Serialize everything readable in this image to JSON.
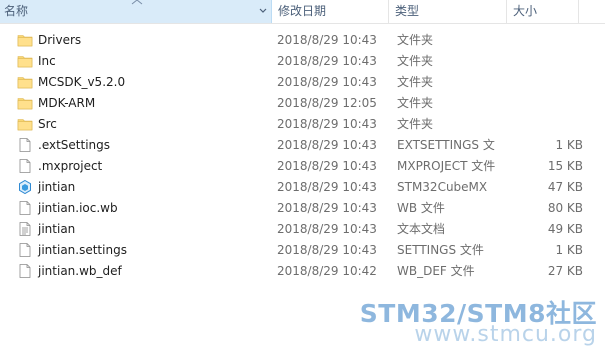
{
  "header": {
    "name": "名称",
    "date": "修改日期",
    "type": "类型",
    "size": "大小"
  },
  "files": [
    {
      "name": "Drivers",
      "date": "2018/8/29 10:43",
      "type": "文件夹",
      "size": "",
      "icon": "folder-icon"
    },
    {
      "name": "Inc",
      "date": "2018/8/29 10:43",
      "type": "文件夹",
      "size": "",
      "icon": "folder-icon"
    },
    {
      "name": "MCSDK_v5.2.0",
      "date": "2018/8/29 10:43",
      "type": "文件夹",
      "size": "",
      "icon": "folder-icon"
    },
    {
      "name": "MDK-ARM",
      "date": "2018/8/29 12:05",
      "type": "文件夹",
      "size": "",
      "icon": "folder-icon"
    },
    {
      "name": "Src",
      "date": "2018/8/29 10:43",
      "type": "文件夹",
      "size": "",
      "icon": "folder-icon"
    },
    {
      "name": ".extSettings",
      "date": "2018/8/29 10:43",
      "type": "EXTSETTINGS 文",
      "size": "1 KB",
      "icon": "file-icon"
    },
    {
      "name": ".mxproject",
      "date": "2018/8/29 10:43",
      "type": "MXPROJECT 文件",
      "size": "15 KB",
      "icon": "file-icon"
    },
    {
      "name": "jintian",
      "date": "2018/8/29 10:43",
      "type": "STM32CubeMX",
      "size": "47 KB",
      "icon": "cubemx-icon"
    },
    {
      "name": "jintian.ioc.wb",
      "date": "2018/8/29 10:43",
      "type": "WB 文件",
      "size": "80 KB",
      "icon": "file-icon"
    },
    {
      "name": "jintian",
      "date": "2018/8/29 10:43",
      "type": "文本文档",
      "size": "49 KB",
      "icon": "text-document-icon"
    },
    {
      "name": "jintian.settings",
      "date": "2018/8/29 10:43",
      "type": "SETTINGS 文件",
      "size": "1 KB",
      "icon": "file-icon"
    },
    {
      "name": "jintian.wb_def",
      "date": "2018/8/29 10:42",
      "type": "WB_DEF 文件",
      "size": "27 KB",
      "icon": "file-icon"
    }
  ],
  "watermark": {
    "line1": "STM32/STM8社区",
    "line2": "www.stmcu.org"
  },
  "colors": {
    "header_selected_bg": "#d9ebf9",
    "header_text": "#4c607a",
    "folder": "#f8d775",
    "secondary_text": "#6d6d6d"
  }
}
